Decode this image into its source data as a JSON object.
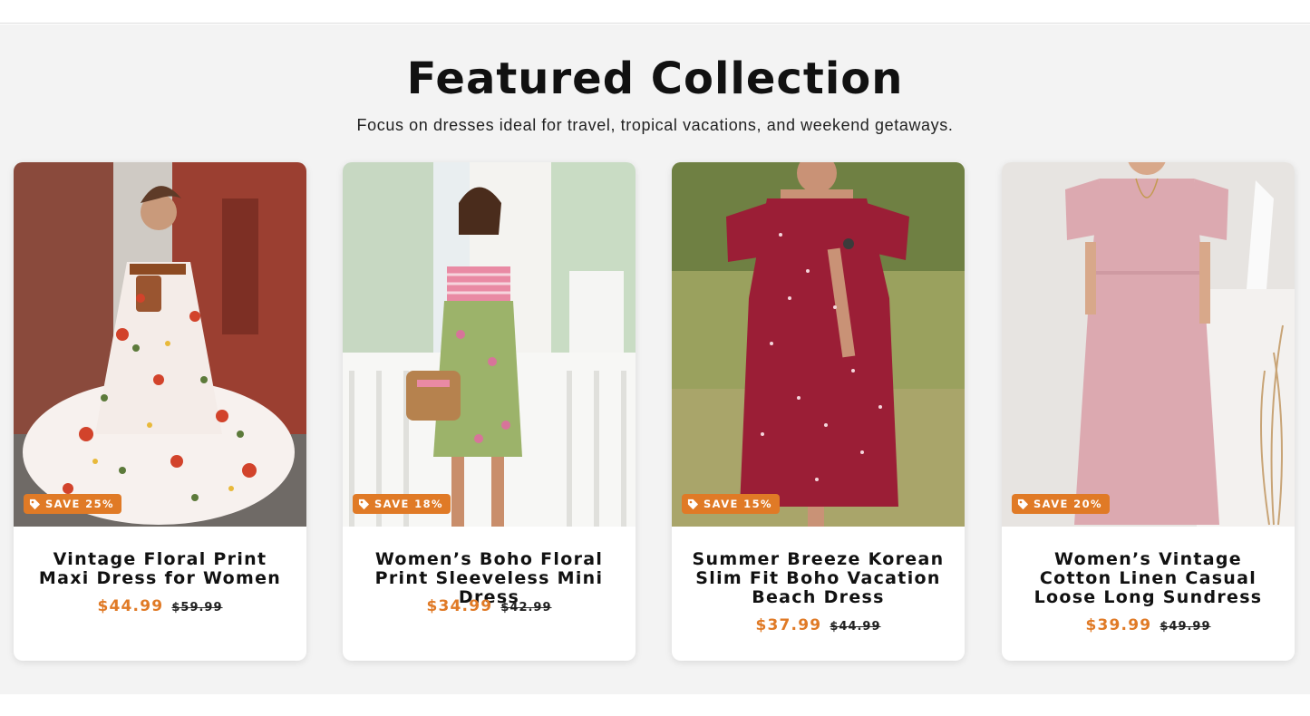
{
  "section": {
    "title": "Featured Collection",
    "subtitle": "Focus on dresses ideal for travel, tropical vacations, and weekend getaways."
  },
  "colors": {
    "accent": "#e07a26",
    "badge_bg": "#e07a26",
    "section_bg": "#f3f3f3"
  },
  "products": [
    {
      "badge": "SAVE 25%",
      "title": "Vintage Floral Print Maxi Dress for Women",
      "price": "$44.99",
      "compare_price": "$59.99",
      "badge_icon": "price-tag-icon"
    },
    {
      "badge": "SAVE 18%",
      "title": "Women’s Boho Floral Print Sleeveless Mini Dress",
      "price": "$34.99",
      "compare_price": "$42.99",
      "badge_icon": "price-tag-icon"
    },
    {
      "badge": "SAVE 15%",
      "title": "Summer Breeze Korean Slim Fit Boho Vacation Beach Dress",
      "price": "$37.99",
      "compare_price": "$44.99",
      "badge_icon": "price-tag-icon"
    },
    {
      "badge": "SAVE 20%",
      "title": "Women’s Vintage Cotton Linen Casual Loose Long Sundress",
      "price": "$39.99",
      "compare_price": "$49.99",
      "badge_icon": "price-tag-icon"
    }
  ]
}
